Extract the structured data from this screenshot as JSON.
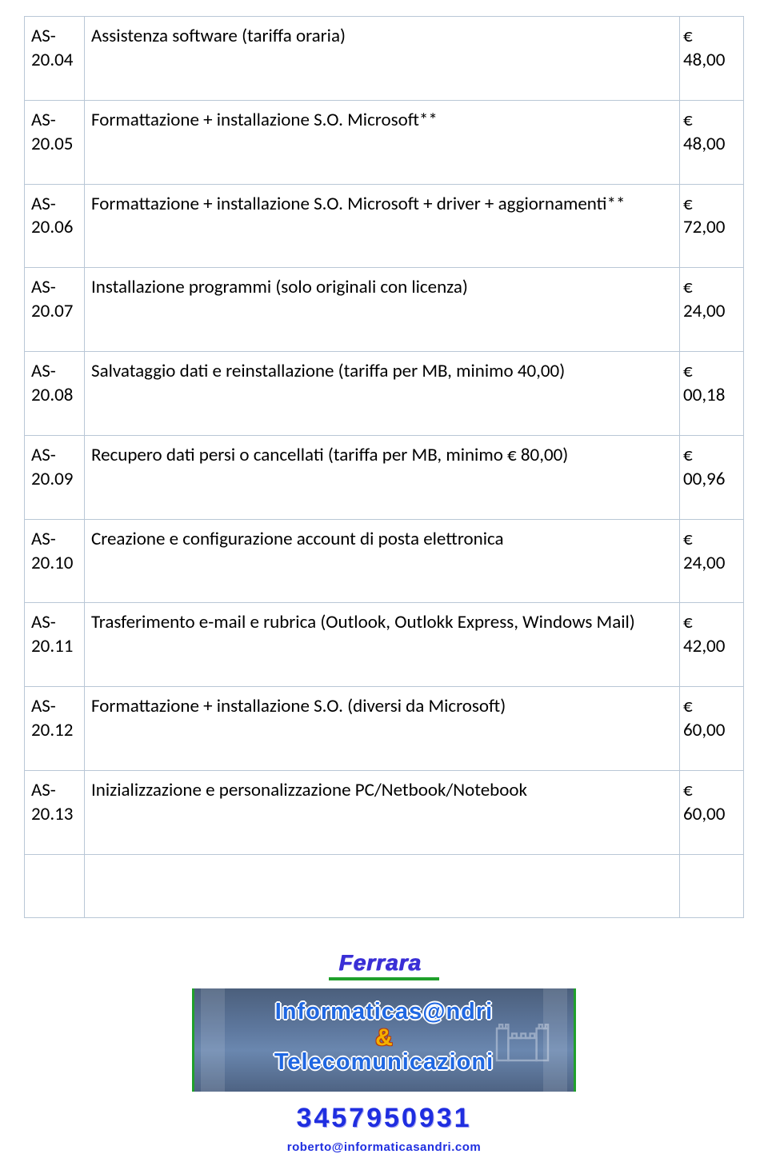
{
  "rows": [
    {
      "code": "AS-20.04",
      "desc": "Assistenza software (tariffa oraria)",
      "price": "€ 48,00"
    },
    {
      "code": "AS-20.05",
      "desc": "Formattazione + installazione S.O. Microsoft**",
      "price": "€ 48,00"
    },
    {
      "code": "AS-20.06",
      "desc": "Formattazione + installazione S.O. Microsoft + driver + aggiornamenti**",
      "price": "€ 72,00"
    },
    {
      "code": "AS-20.07",
      "desc": "Installazione programmi (solo originali con licenza)",
      "price": "€ 24,00"
    },
    {
      "code": "AS-20.08",
      "desc": "Salvataggio dati e reinstallazione (tariffa per MB, minimo 40,00)",
      "price": "€ 00,18"
    },
    {
      "code": "AS-20.09",
      "desc": "Recupero dati persi o cancellati (tariffa per MB, minimo € 80,00)",
      "price": "€ 00,96"
    },
    {
      "code": "AS-20.10",
      "desc": "Creazione e configurazione account di posta elettronica",
      "price": "€ 24,00"
    },
    {
      "code": "AS-20.11",
      "desc": "Trasferimento e-mail e rubrica (Outlook, Outlokk Express, Windows Mail)",
      "price": "€ 42,00"
    },
    {
      "code": "AS-20.12",
      "desc": "Formattazione + installazione S.O. (diversi da Microsoft)",
      "price": "€ 60,00"
    },
    {
      "code": "AS-20.13",
      "desc": "Inizializzazione e personalizzazione PC/Netbook/Notebook",
      "price": "€ 60,00"
    }
  ],
  "footer": {
    "city": "Ferrara",
    "brand1": "Informaticas@ndri",
    "amp": "&",
    "brand2": "Telecomunicazioni",
    "phone": "3457950931",
    "email": "roberto@informaticasandri.com"
  }
}
